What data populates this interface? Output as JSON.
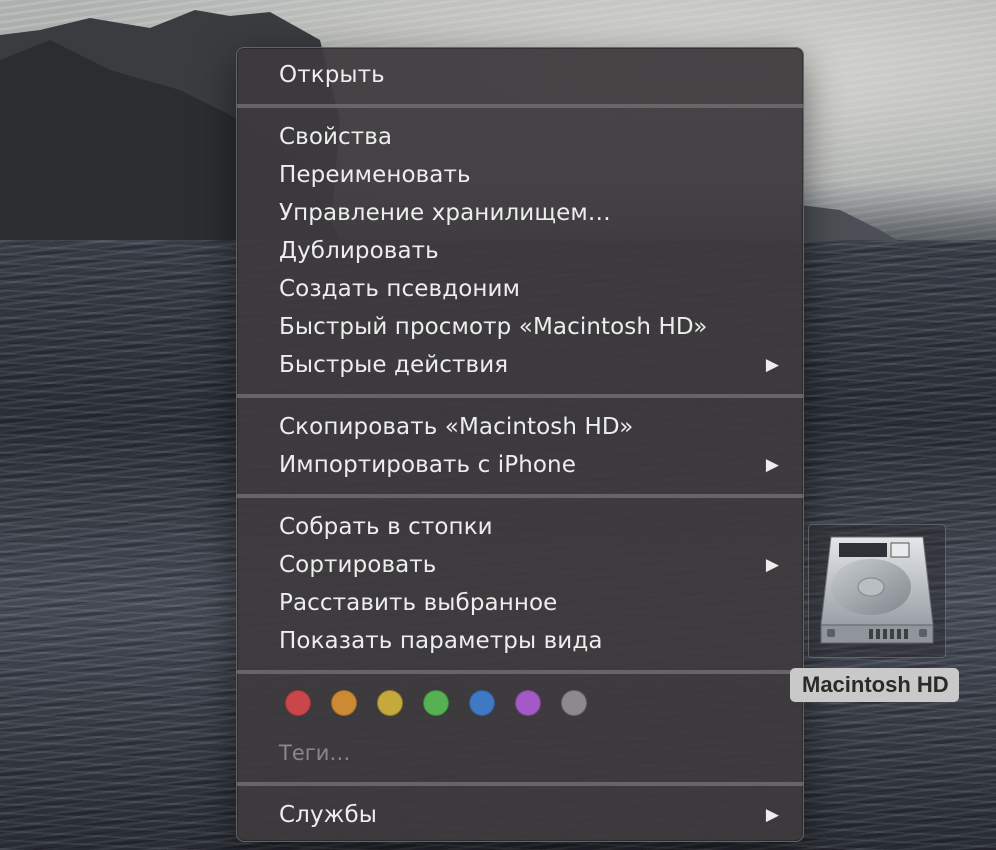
{
  "context_menu": {
    "groups": [
      [
        {
          "label": "Открыть",
          "submenu": false
        }
      ],
      [
        {
          "label": "Свойства",
          "submenu": false
        },
        {
          "label": "Переименовать",
          "submenu": false
        },
        {
          "label": "Управление хранилищем…",
          "submenu": false
        },
        {
          "label": "Дублировать",
          "submenu": false
        },
        {
          "label": "Создать псевдоним",
          "submenu": false
        },
        {
          "label": "Быстрый просмотр «Macintosh HD»",
          "submenu": false
        },
        {
          "label": "Быстрые действия",
          "submenu": true
        }
      ],
      [
        {
          "label": "Скопировать «Macintosh HD»",
          "submenu": false
        },
        {
          "label": "Импортировать с iPhone",
          "submenu": true
        }
      ],
      [
        {
          "label": "Собрать в стопки",
          "submenu": false
        },
        {
          "label": "Сортировать",
          "submenu": true
        },
        {
          "label": "Расставить выбранное",
          "submenu": false
        },
        {
          "label": "Показать параметры вида",
          "submenu": false
        }
      ]
    ],
    "tag_colors": [
      "#c9474b",
      "#cc8a35",
      "#c7a83a",
      "#55b152",
      "#3f78c3",
      "#a45ac6",
      "#8c8a8e"
    ],
    "tags_label": "Теги…",
    "services_label": "Службы",
    "submenu_arrow": "▶"
  },
  "desktop": {
    "drive_label": "Macintosh HD",
    "drive_icon": "hard-drive-icon"
  }
}
